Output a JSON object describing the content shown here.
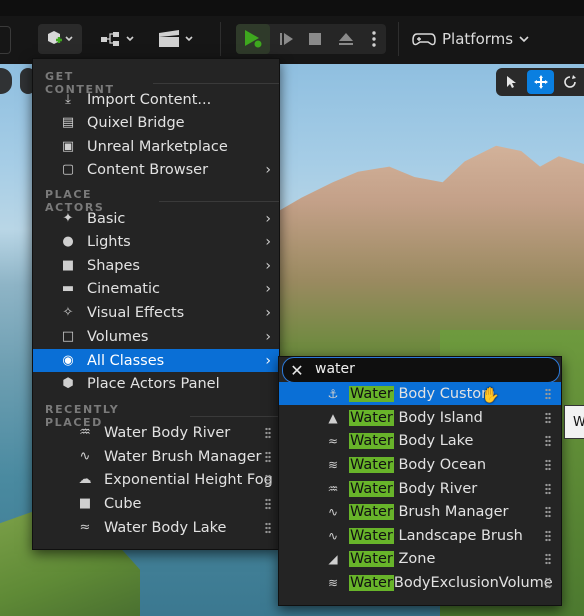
{
  "toolbar": {
    "platforms_label": "Platforms",
    "accent": "#3ea81e"
  },
  "menu": {
    "sections": {
      "get_content": "GET CONTENT",
      "place_actors": "PLACE ACTORS",
      "recently_placed": "RECENTLY PLACED"
    },
    "get_content_items": [
      {
        "label": "Import Content...",
        "icon": "import-icon"
      },
      {
        "label": "Quixel Bridge",
        "icon": "bridge-icon"
      },
      {
        "label": "Unreal Marketplace",
        "icon": "marketplace-icon"
      },
      {
        "label": "Content Browser",
        "icon": "folder-icon",
        "has_submenu": true
      }
    ],
    "place_actor_items": [
      {
        "label": "Basic",
        "icon": "basic-icon"
      },
      {
        "label": "Lights",
        "icon": "light-icon"
      },
      {
        "label": "Shapes",
        "icon": "shapes-icon"
      },
      {
        "label": "Cinematic",
        "icon": "cinematic-icon"
      },
      {
        "label": "Visual Effects",
        "icon": "vfx-icon"
      },
      {
        "label": "Volumes",
        "icon": "volume-icon"
      },
      {
        "label": "All Classes",
        "icon": "all-classes-icon",
        "highlighted": true
      },
      {
        "label": "Place Actors Panel",
        "icon": "place-actors-icon",
        "has_submenu": false
      }
    ],
    "recent_items": [
      {
        "label": "Water Body River",
        "icon": "river-icon"
      },
      {
        "label": "Water Brush Manager",
        "icon": "brush-manager-icon"
      },
      {
        "label": "Exponential Height Fog",
        "icon": "fog-icon"
      },
      {
        "label": "Cube",
        "icon": "cube-icon"
      },
      {
        "label": "Water Body Lake",
        "icon": "lake-icon"
      }
    ]
  },
  "search": {
    "value": "water"
  },
  "results": [
    {
      "match": "Water",
      "rest": " Body Custom",
      "icon": "water-custom-icon",
      "highlighted": true
    },
    {
      "match": "Water",
      "rest": " Body Island",
      "icon": "island-icon"
    },
    {
      "match": "Water",
      "rest": " Body Lake",
      "icon": "lake-icon"
    },
    {
      "match": "Water",
      "rest": " Body Ocean",
      "icon": "ocean-icon"
    },
    {
      "match": "Water",
      "rest": " Body River",
      "icon": "river-icon"
    },
    {
      "match": "Water",
      "rest": " Brush Manager",
      "icon": "brush-manager-icon"
    },
    {
      "match": "Water",
      "rest": " Landscape Brush",
      "icon": "landscape-brush-icon"
    },
    {
      "match": "Water",
      "rest": " Zone",
      "icon": "zone-icon"
    },
    {
      "match": "Water",
      "rest": "BodyExclusionVolume",
      "icon": "exclusion-volume-icon"
    }
  ],
  "tooltip": {
    "text": "W"
  }
}
